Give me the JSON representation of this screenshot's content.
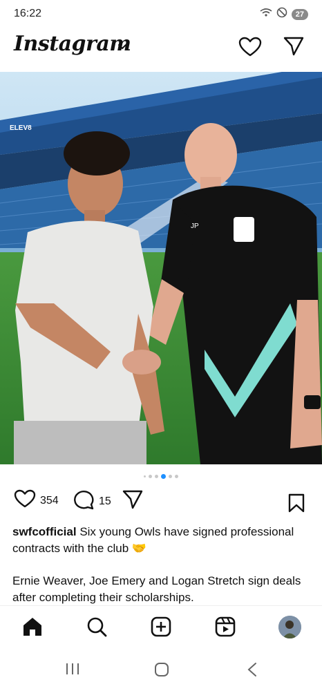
{
  "status_bar": {
    "time": "16:22",
    "battery": "27"
  },
  "header": {
    "logo_text": "Instagram"
  },
  "post": {
    "carousel": {
      "total": 6,
      "active_index": 3
    },
    "likes": "354",
    "comments": "15",
    "username": "swfcofficial",
    "caption_line1": " Six young Owls have signed professional contracts with the club 🤝",
    "caption_line2": "Ernie Weaver, Joe Emery and Logan Stretch sign deals after completing their scholarships.",
    "shirt_initials": "JP",
    "stand_banner_text": "ELEV8"
  },
  "bottom_nav": [
    "home-icon",
    "search-icon",
    "create-icon",
    "reels-icon",
    "profile-avatar"
  ],
  "colors": {
    "accent_blue": "#1e90ff",
    "teal_chevron": "#7fdcd0",
    "pitch_green": "#3f8d3a"
  }
}
